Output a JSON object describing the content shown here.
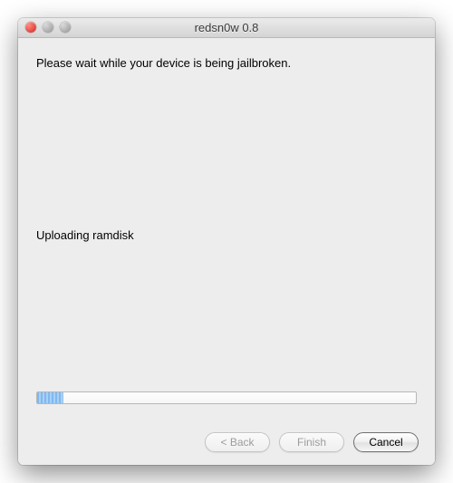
{
  "window": {
    "title": "redsn0w 0.8"
  },
  "content": {
    "instruction": "Please wait while your device is being jailbroken.",
    "status": "Uploading ramdisk"
  },
  "progress": {
    "percent": 7
  },
  "buttons": {
    "back": "< Back",
    "finish": "Finish",
    "cancel": "Cancel"
  }
}
